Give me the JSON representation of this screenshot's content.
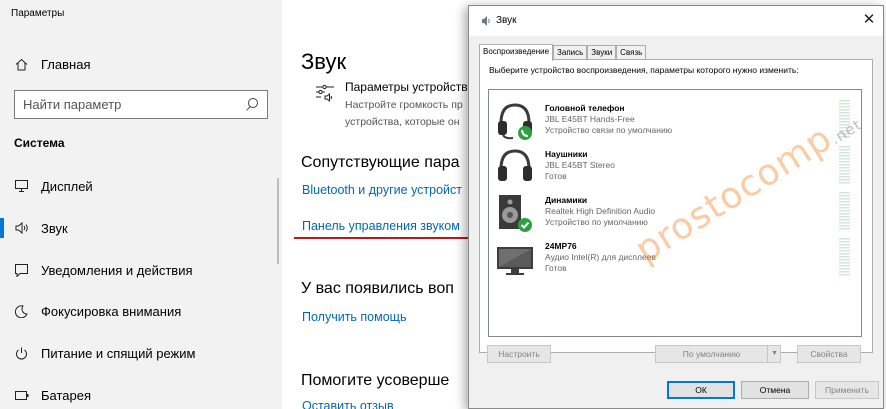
{
  "settings": {
    "app_title": "Параметры",
    "home_label": "Главная",
    "search_placeholder": "Найти параметр",
    "section_title": "Система",
    "nav": [
      {
        "label": "Дисплей",
        "icon": "monitor-icon"
      },
      {
        "label": "Звук",
        "icon": "speaker-icon",
        "active": true
      },
      {
        "label": "Уведомления и действия",
        "icon": "notification-icon"
      },
      {
        "label": "Фокусировка внимания",
        "icon": "moon-icon"
      },
      {
        "label": "Питание и спящий режим",
        "icon": "power-icon"
      },
      {
        "label": "Батарея",
        "icon": "battery-icon"
      }
    ],
    "content": {
      "page_title": "Звук",
      "sound_panel_title": "Параметры устройств",
      "sound_panel_desc_1": "Настройте громкость пр",
      "sound_panel_desc_2": "устройства, которые он",
      "related_heading": "Сопутствующие пара",
      "link_bluetooth": "Bluetooth и другие устройст",
      "link_sound_panel": "Панель управления звуком",
      "questions_heading": "У вас появились воп",
      "link_help": "Получить помощь",
      "improve_heading": "Помогите усоверше",
      "link_feedback": "Оставить отзыв"
    }
  },
  "dialog": {
    "title": "Звук",
    "close_glyph": "✕",
    "tabs": [
      "Воспроизведение",
      "Запись",
      "Звуки",
      "Связь"
    ],
    "instruction": "Выберите устройство воспроизведения, параметры которого нужно изменить:",
    "devices": [
      {
        "name": "Головной телефон",
        "line1": "JBL E45BT Hands-Free",
        "line2": "Устройство связи по умолчанию",
        "icon": "headset-icon",
        "badge": "phone-badge-icon"
      },
      {
        "name": "Наушники",
        "line1": "JBL E45BT Stereo",
        "line2": "Готов",
        "icon": "headphones-icon"
      },
      {
        "name": "Динамики",
        "line1": "Realtek High Definition Audio",
        "line2": "Устройство по умолчанию",
        "icon": "speaker-device-icon",
        "badge": "check-badge-icon"
      },
      {
        "name": "24MP76",
        "line1": "Аудио Intel(R) для дисплеев",
        "line2": "Готов",
        "icon": "monitor-device-icon"
      }
    ],
    "buttons": {
      "configure": "Настроить",
      "default": "По умолчанию",
      "properties": "Свойства",
      "ok": "ОК",
      "cancel": "Отмена",
      "apply": "Применить"
    }
  },
  "watermark": {
    "main": "prostocomp",
    "suffix": ".net"
  },
  "colors": {
    "accent": "#0078d7",
    "link": "#0067b8",
    "badge_green": "#2ea043",
    "underline_red": "#d01010"
  }
}
